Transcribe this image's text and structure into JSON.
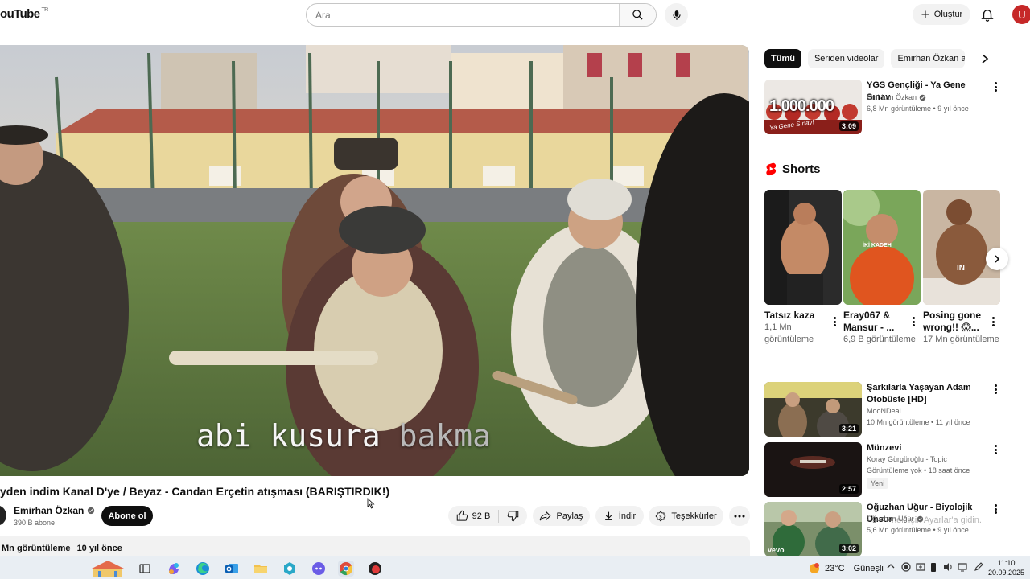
{
  "header": {
    "logo_text": "ouTube",
    "logo_region": "TR",
    "search_placeholder": "Ara",
    "create_label": "Oluştur",
    "avatar_letter": "U"
  },
  "player": {
    "caption_main": "abi kusura ",
    "caption_dim": "bakma"
  },
  "video": {
    "title": "yden indim Kanal D'ye / Beyaz - Candan Erçetin atışması (BARIŞTIRDIK!)",
    "channel_name": "Emirhan Özkan",
    "subscribers": "390 B abone",
    "subscribe_label": "Abone ol",
    "likes": "92 B",
    "share_label": "Paylaş",
    "download_label": "İndir",
    "thanks_label": "Teşekkürler",
    "views": "Mn görüntüleme",
    "age": "10 yıl önce"
  },
  "chips": [
    "Tümü",
    "Seriden videolar",
    "Emirhan Özkan adlı y"
  ],
  "recommendations_top": [
    {
      "title": "YGS Gençliği - Ya Gene Sınav",
      "channel": "Emirhan Özkan",
      "verified": true,
      "meta": "6,8 Mn görüntüleme • 9 yıl önce",
      "duration": "3:09",
      "thumb_text": "1.000.000",
      "thumb_sub": "Ya Gene Sınav!"
    }
  ],
  "shorts": {
    "heading": "Shorts",
    "items": [
      {
        "title": "Tatsız kaza",
        "views": "1,1 Mn görüntüleme"
      },
      {
        "title": "Eray067 & Mansur - ...",
        "views": "6,9 B görüntüleme",
        "thumb_text": "İKİ KADEH"
      },
      {
        "title": "Posing gone wrong!! 😱...",
        "views": "17 Mn görüntüleme",
        "thumb_text": "IN"
      }
    ]
  },
  "recommendations": [
    {
      "title": "Şarkılarla Yaşayan Adam Otobüste [HD]",
      "channel": "MooNDeaL",
      "verified": false,
      "meta": "10 Mn görüntüleme • 11 yıl önce",
      "duration": "3:21"
    },
    {
      "title": "Münzevi",
      "channel": "Koray Gürgüroğlu - Topic",
      "verified": false,
      "meta": "Görüntüleme yok • 18 saat önce",
      "badge": "Yeni",
      "duration": "2:57"
    },
    {
      "title": "Oğuzhan Uğur - Biyolojik Unsur",
      "channel": "Oğuzhan Uğur",
      "verified": true,
      "meta": "5,6 Mn görüntüleme • 9 yıl önce",
      "duration": "3:02",
      "thumb_text": "vevo"
    }
  ],
  "watermark": "nek için Ayarlar'a gidin.",
  "taskbar": {
    "temperature": "23°C",
    "weather_text": "Güneşli",
    "time": "11:10",
    "date": "20.09.2025"
  },
  "colors": {
    "accent_red": "#ff0000",
    "text_primary": "#0f0f0f",
    "text_secondary": "#606060",
    "chip_bg": "#f2f2f2"
  }
}
